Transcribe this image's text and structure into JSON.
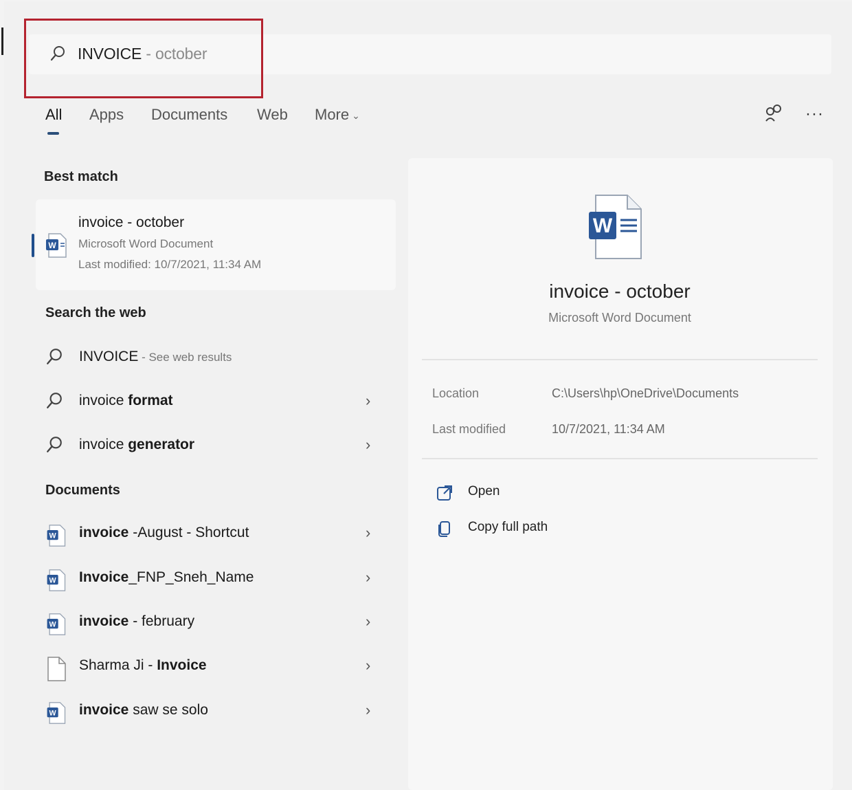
{
  "search": {
    "query": "INVOICE",
    "completion": " - october"
  },
  "tabs": [
    {
      "label": "All"
    },
    {
      "label": "Apps"
    },
    {
      "label": "Documents"
    },
    {
      "label": "Web"
    },
    {
      "label": "More"
    }
  ],
  "best_match": {
    "heading": "Best match",
    "name": "invoice - october",
    "type": "Microsoft Word Document",
    "modified": "Last modified: 10/7/2021, 11:34 AM"
  },
  "web": {
    "heading": "Search the web",
    "items": [
      {
        "prefix": "INVOICE",
        "suffix": " - See web results",
        "has_arrow": false
      },
      {
        "prefix": "invoice ",
        "bold": "format",
        "has_arrow": true
      },
      {
        "prefix": "invoice ",
        "bold": "generator",
        "has_arrow": true
      }
    ]
  },
  "documents": {
    "heading": "Documents",
    "items": [
      {
        "bold": "invoice",
        "rest": " -August - Shortcut",
        "icon": "word-doc-icon"
      },
      {
        "bold": "Invoice",
        "rest": "_FNP_Sneh_Name",
        "icon": "word-doc-icon"
      },
      {
        "bold": "invoice",
        "rest": " - february",
        "icon": "word-doc-icon"
      },
      {
        "pre": "Sharma Ji - ",
        "bold": "Invoice",
        "icon": "blank-file-icon"
      },
      {
        "bold": "invoice",
        "rest": " saw se solo",
        "icon": "word-doc-icon"
      }
    ]
  },
  "preview": {
    "title": "invoice - october",
    "subtitle": "Microsoft Word Document",
    "location_label": "Location",
    "location_value": "C:\\Users\\hp\\OneDrive\\Documents",
    "modified_label": "Last modified",
    "modified_value": "10/7/2021, 11:34 AM",
    "actions": [
      {
        "label": "Open",
        "icon": "open-external-icon"
      },
      {
        "label": "Copy full path",
        "icon": "copy-icon"
      }
    ]
  },
  "colors": {
    "accent": "#1f4e8c",
    "highlight_box": "#b4232f",
    "word_blue": "#2b5797"
  }
}
